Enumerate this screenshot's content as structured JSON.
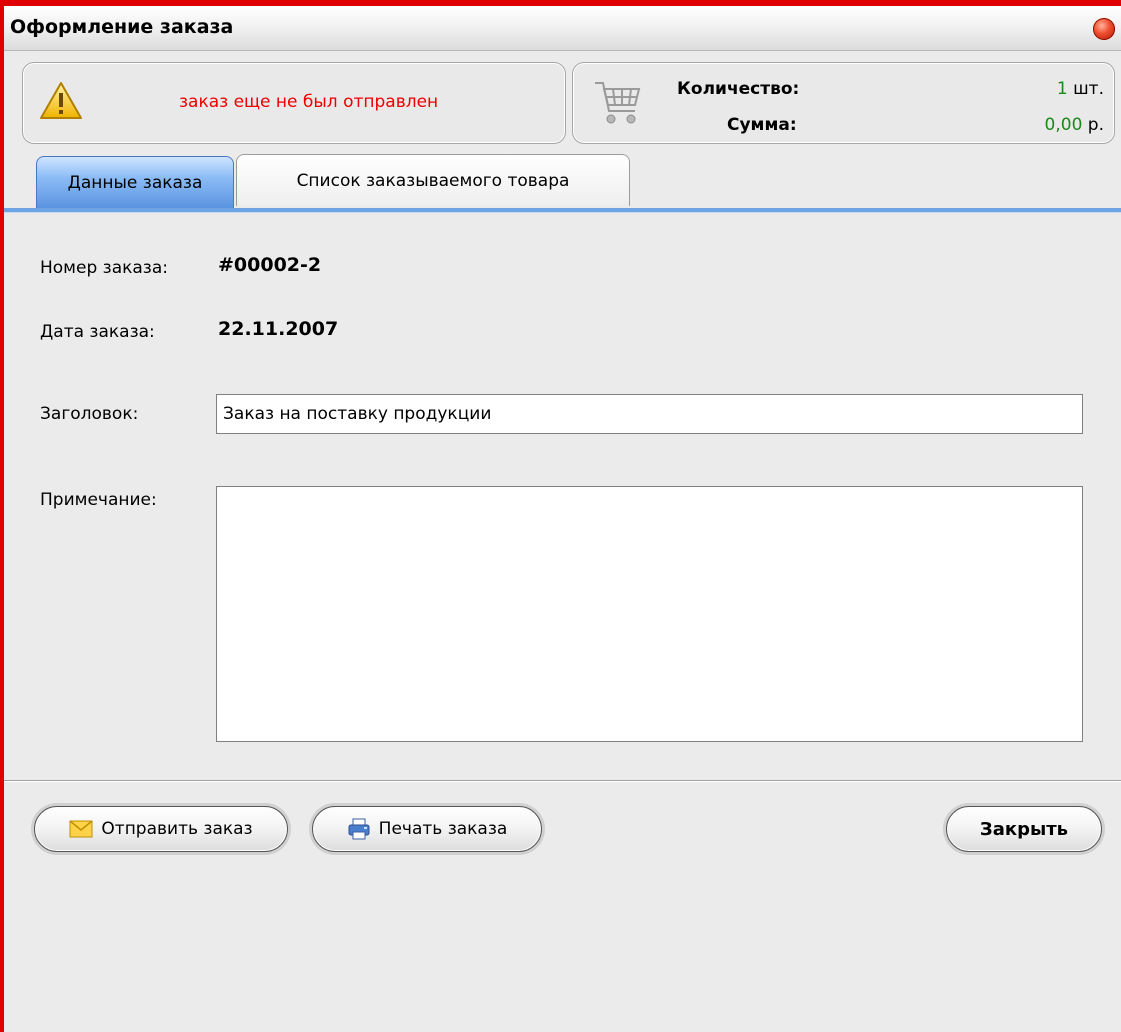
{
  "window": {
    "title": "Оформление заказа"
  },
  "status": {
    "message": "заказ еще не был отправлен",
    "message_color": "#ee0000"
  },
  "summary": {
    "quantity_label": "Количество:",
    "quantity_value": "1",
    "quantity_unit": "шт.",
    "sum_label": "Сумма:",
    "sum_value": "0,00",
    "sum_unit": "р.",
    "value_color": "#1a8a1a"
  },
  "tabs": [
    {
      "label": "Данные заказа",
      "active": true
    },
    {
      "label": "Список заказываемого товара",
      "active": false
    }
  ],
  "form": {
    "order_number_label": "Номер заказа:",
    "order_number": "#00002-2",
    "order_date_label": "Дата заказа:",
    "order_date": "22.11.2007",
    "title_label": "Заголовок:",
    "title_value": "Заказ на поставку продукции",
    "notes_label": "Примечание:",
    "notes_value": ""
  },
  "buttons": {
    "send": "Отправить заказ",
    "print": "Печать заказа",
    "close": "Закрыть"
  },
  "icons": {
    "close": "close-dot-icon",
    "warning": "warning-icon",
    "cart": "shopping-cart-icon",
    "envelope": "envelope-icon",
    "printer": "printer-icon"
  }
}
